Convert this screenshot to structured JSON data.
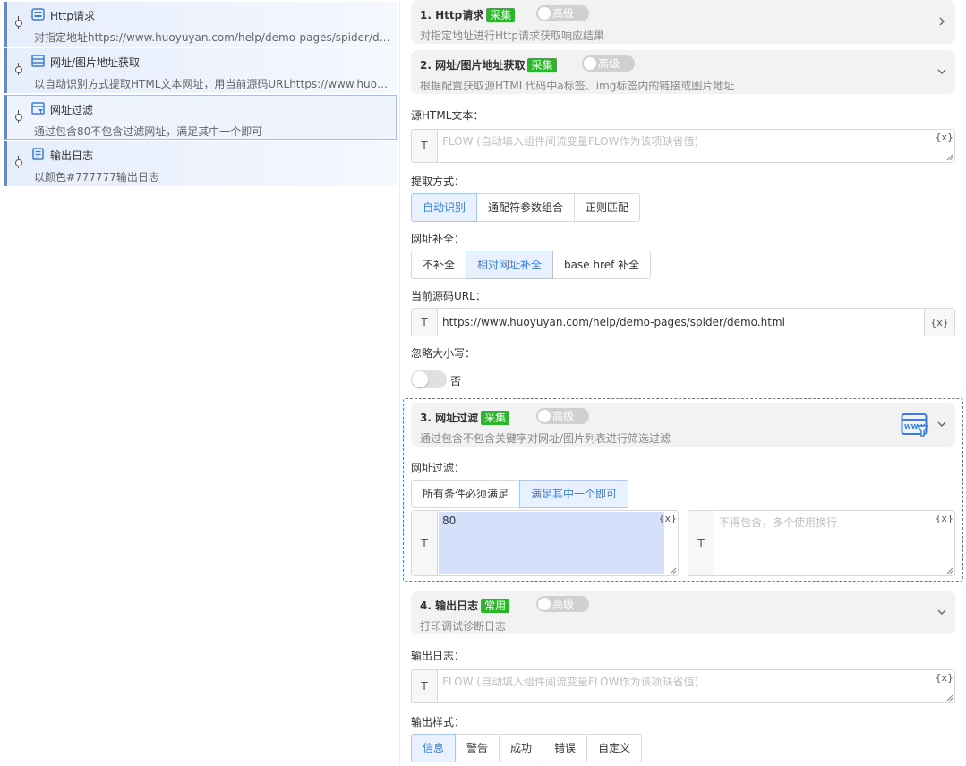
{
  "steps": [
    {
      "title": "Http请求",
      "desc": "对指定地址https://www.huoyuyan.com/help/demo-pages/spider/demo.html获取响应结果"
    },
    {
      "title": "网址/图片地址获取",
      "desc": "以自动识别方式提取HTML文本网址，用当前源码URLhttps://www.huoyuyan.com/help/demo-pages/spider/demo.html补全"
    },
    {
      "title": "网址过滤",
      "desc": "通过包含80不包含过滤网址，满足其中一个即可"
    },
    {
      "title": "输出日志",
      "desc": "以颜色#777777输出日志"
    }
  ],
  "cards": [
    {
      "title": "1. Http请求",
      "badge": "采集",
      "adv": "高级",
      "desc": "对指定地址进行Http请求获取响应结果"
    },
    {
      "title": "2. 网址/图片地址获取",
      "badge": "采集",
      "adv": "高级",
      "desc": "根据配置获取源HTML代码中a标签、img标签内的链接或图片地址"
    },
    {
      "title": "3. 网址过滤",
      "badge": "采集",
      "adv": "高级",
      "desc": "通过包含不包含关键字对网址/图片列表进行筛选过滤"
    },
    {
      "title": "4. 输出日志",
      "badge": "常用",
      "adv": "高级",
      "desc": "打印调试诊断日志"
    }
  ],
  "form2": {
    "source_label": "源HTML文本：",
    "source_placeholder": "FLOW (自动填入组件间流变量FLOW作为该项缺省值)",
    "extract_label": "提取方式：",
    "extract_options": [
      "自动识别",
      "通配符参数组合",
      "正则匹配"
    ],
    "complete_label": "网址补全：",
    "complete_options": [
      "不补全",
      "相对网址补全",
      "base href 补全"
    ],
    "url_label": "当前源码URL：",
    "url_value": "https://www.huoyuyan.com/help/demo-pages/spider/demo.html",
    "ignore_case_label": "忽略大小写：",
    "ignore_case_value": "否"
  },
  "form3": {
    "filter_label": "网址过滤：",
    "filter_options": [
      "所有条件必须满足",
      "满足其中一个即可"
    ],
    "include_value": "80",
    "exclude_placeholder": "不得包含，多个使用换行"
  },
  "form4": {
    "log_label": "输出日志：",
    "log_placeholder": "FLOW (自动填入组件间流变量FLOW作为该项缺省值)",
    "style_label": "输出样式：",
    "style_options": [
      "信息",
      "警告",
      "成功",
      "错误",
      "自定义"
    ]
  },
  "common": {
    "text_prefix": "T",
    "var_token": "{x}"
  },
  "colors": {
    "accent": "#3a7fd8",
    "badge_green": "#2bb52b",
    "card_bg": "#f2f2f2"
  }
}
